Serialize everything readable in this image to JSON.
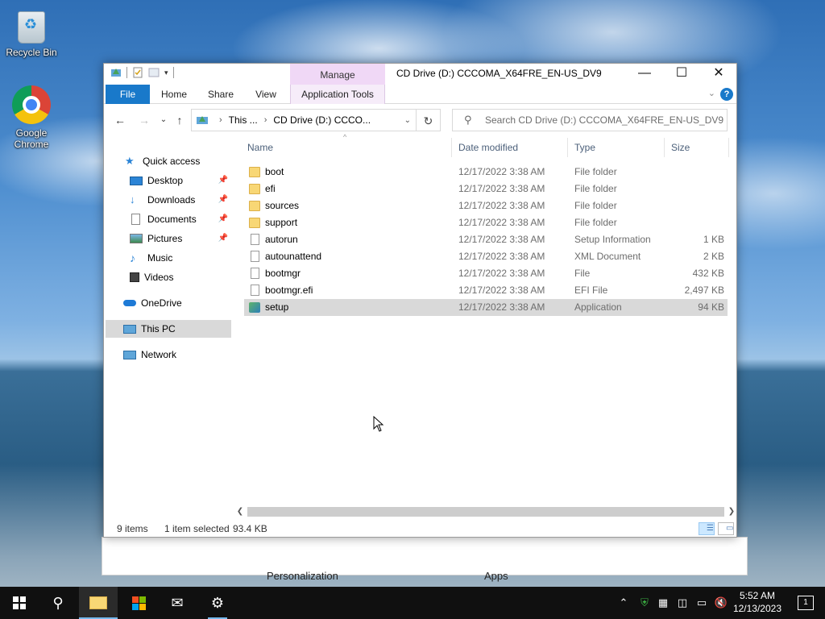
{
  "desktop": {
    "icons": [
      {
        "label": "Recycle Bin"
      },
      {
        "label": "Google Chrome"
      }
    ]
  },
  "window": {
    "title": "CD Drive (D:) CCCOMA_X64FRE_EN-US_DV9",
    "context_tab": "Manage",
    "controls": {
      "minimize": "—",
      "maximize": "☐",
      "close": "✕"
    }
  },
  "ribbon": {
    "tabs": [
      "File",
      "Home",
      "Share",
      "View",
      "Application Tools"
    ],
    "help": "?"
  },
  "address": {
    "segments": [
      "This ...",
      "CD Drive (D:) CCCO..."
    ],
    "search_placeholder": "Search CD Drive (D:) CCCOMA_X64FRE_EN-US_DV9"
  },
  "nav": {
    "items": [
      {
        "label": "Quick access"
      },
      {
        "label": "Desktop"
      },
      {
        "label": "Downloads"
      },
      {
        "label": "Documents"
      },
      {
        "label": "Pictures"
      },
      {
        "label": "Music"
      },
      {
        "label": "Videos"
      },
      {
        "label": "OneDrive"
      },
      {
        "label": "This PC"
      },
      {
        "label": "Network"
      }
    ]
  },
  "columns": {
    "name": "Name",
    "date": "Date modified",
    "type": "Type",
    "size": "Size"
  },
  "files": [
    {
      "name": "boot",
      "date": "12/17/2022 3:38 AM",
      "type": "File folder",
      "size": "",
      "icon": "folder-icon"
    },
    {
      "name": "efi",
      "date": "12/17/2022 3:38 AM",
      "type": "File folder",
      "size": "",
      "icon": "folder-icon"
    },
    {
      "name": "sources",
      "date": "12/17/2022 3:38 AM",
      "type": "File folder",
      "size": "",
      "icon": "folder-icon"
    },
    {
      "name": "support",
      "date": "12/17/2022 3:38 AM",
      "type": "File folder",
      "size": "",
      "icon": "folder-icon"
    },
    {
      "name": "autorun",
      "date": "12/17/2022 3:38 AM",
      "type": "Setup Information",
      "size": "1 KB",
      "icon": "settings-file-icon"
    },
    {
      "name": "autounattend",
      "date": "12/17/2022 3:38 AM",
      "type": "XML Document",
      "size": "2 KB",
      "icon": "xml-file-icon"
    },
    {
      "name": "bootmgr",
      "date": "12/17/2022 3:38 AM",
      "type": "File",
      "size": "432 KB",
      "icon": "file-icon"
    },
    {
      "name": "bootmgr.efi",
      "date": "12/17/2022 3:38 AM",
      "type": "EFI File",
      "size": "2,497 KB",
      "icon": "file-icon"
    },
    {
      "name": "setup",
      "date": "12/17/2022 3:38 AM",
      "type": "Application",
      "size": "94 KB",
      "icon": "setup-app-icon"
    }
  ],
  "status": {
    "item_count": "9 items",
    "selection": "1 item selected",
    "selection_size": "93.4 KB"
  },
  "back_window": {
    "left_label": "Personalization",
    "right_label": "Apps"
  },
  "taskbar": {
    "time": "5:52 AM",
    "date": "12/13/2023",
    "notification_count": "1"
  }
}
